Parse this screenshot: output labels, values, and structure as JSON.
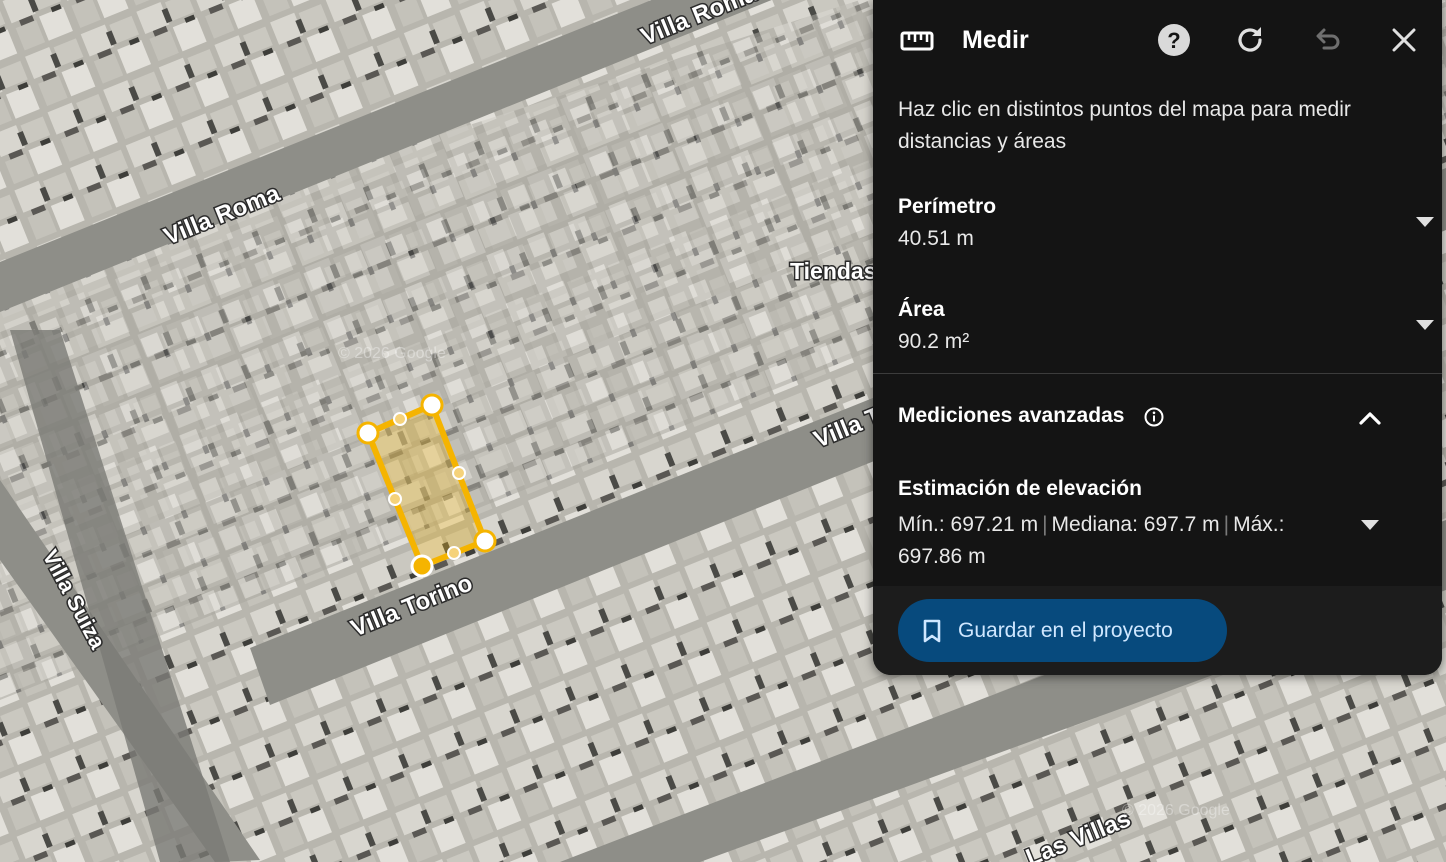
{
  "map": {
    "streets": {
      "villa_roma_top": "Villa Roma",
      "villa_roma": "Villa Roma",
      "tiendas": "Tiendas",
      "villa_t": "Villa T",
      "villa_torino": "Villa Torino",
      "villa_suiza": "Villa Suiza",
      "las_villas": "Las Villas"
    },
    "watermarks": [
      "© 2026 Google",
      "© 2026 Google"
    ],
    "polygon_color": "#f5b400"
  },
  "panel": {
    "title": "Medir",
    "icons": {
      "tool": "ruler-icon",
      "help": "help-icon",
      "reset": "refresh-icon",
      "undo": "undo-icon",
      "close": "close-icon"
    },
    "instructions": "Haz clic en distintos puntos del mapa para medir distancias y áreas",
    "perimeter": {
      "label": "Perímetro",
      "value": "40.51 m"
    },
    "area": {
      "label": "Área",
      "value": "90.2 m²"
    },
    "advanced": {
      "label": "Mediciones avanzadas"
    },
    "elevation": {
      "label": "Estimación de elevación",
      "min": "Mín.: 697.21 m",
      "median": "Mediana: 697.7 m",
      "max": "Máx.: 697.86 m"
    },
    "save_button": "Guardar en el proyecto",
    "accent": "#074a7d"
  }
}
